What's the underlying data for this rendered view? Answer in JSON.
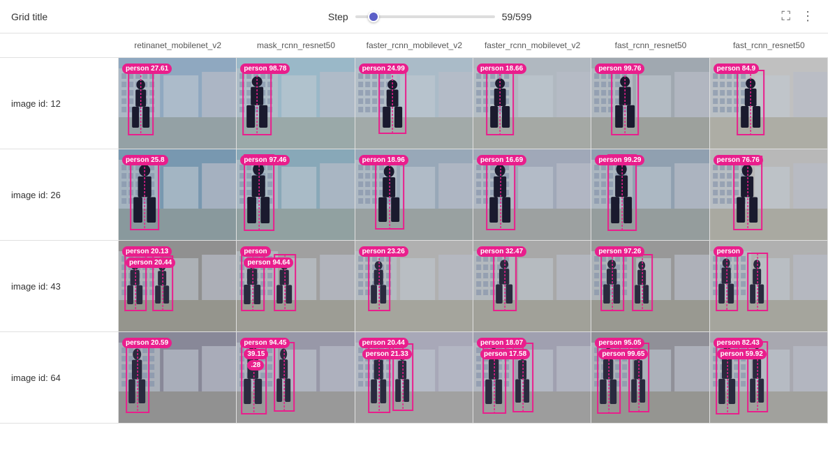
{
  "header": {
    "title": "Grid title",
    "step_label": "Step",
    "step_value": "59/599",
    "step_current": 59,
    "step_max": 599
  },
  "columns": {
    "row_label_prefix": "image id:",
    "headers": [
      "retinanet_mobilenet_v2",
      "mask_rcnn_resnet50",
      "faster_rcnn_mobilevet_v2",
      "faster_rcnn_mobilevet_v2",
      "fast_rcnn_resnet50",
      "fast_rcnn_resnet50"
    ]
  },
  "rows": [
    {
      "id": "12",
      "cells": [
        {
          "label": "person 27.61"
        },
        {
          "label": "person 98.78"
        },
        {
          "label": "person 24.99"
        },
        {
          "label": "person 18.66"
        },
        {
          "label": "person 99.76"
        },
        {
          "label": "person 84.9"
        }
      ]
    },
    {
      "id": "26",
      "cells": [
        {
          "label": "person 25.8"
        },
        {
          "label": "person 97.46"
        },
        {
          "label": "person 18.96"
        },
        {
          "label": "person 16.69"
        },
        {
          "label": "person 99.29"
        },
        {
          "label": "person 76.76"
        }
      ]
    },
    {
      "id": "43",
      "cells": [
        {
          "label": "person 20.13 / person 20.44"
        },
        {
          "label": "person / person 94.64"
        },
        {
          "label": "person 23.26"
        },
        {
          "label": "person 32.47"
        },
        {
          "label": "person 97.26"
        },
        {
          "label": "person"
        }
      ]
    },
    {
      "id": "64",
      "cells": [
        {
          "label": "person 20.59"
        },
        {
          "label": "person 94.45 / 39.15 / .28"
        },
        {
          "label": "person 20.44 / person 21.33"
        },
        {
          "label": "person 18.07 / person 17.58"
        },
        {
          "label": "person 95.05 / person 99.65"
        },
        {
          "label": "person 82.43 / person 59.92"
        }
      ]
    }
  ],
  "icons": {
    "fullscreen": "⛶",
    "menu": "⋮"
  }
}
